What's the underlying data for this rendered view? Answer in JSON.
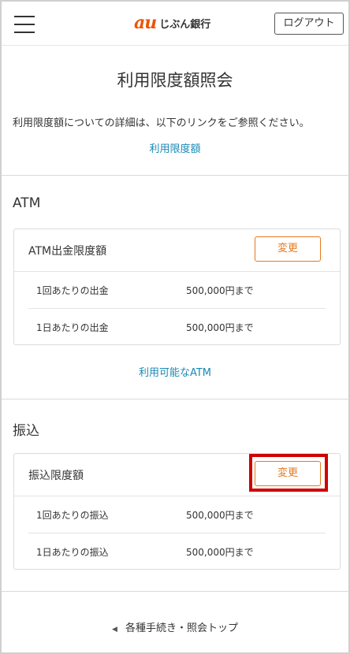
{
  "header": {
    "logo_mark": "au",
    "logo_text": "じぶん銀行",
    "logout_label": "ログアウト"
  },
  "page": {
    "title": "利用限度額照会",
    "intro": "利用限度額についての詳細は、以下のリンクをご参照ください。",
    "limit_link": "利用限度額"
  },
  "atm": {
    "section_title": "ATM",
    "card_title": "ATM出金限度額",
    "change_label": "変更",
    "rows": [
      {
        "label": "1回あたりの出金",
        "value": "500,000円まで"
      },
      {
        "label": "1日あたりの出金",
        "value": "500,000円まで"
      }
    ],
    "available_link": "利用可能なATM"
  },
  "transfer": {
    "section_title": "振込",
    "card_title": "振込限度額",
    "change_label": "変更",
    "rows": [
      {
        "label": "1回あたりの振込",
        "value": "500,000円まで"
      },
      {
        "label": "1日あたりの振込",
        "value": "500,000円まで"
      }
    ]
  },
  "footer": {
    "back_link": "各種手続き・照会トップ"
  },
  "colors": {
    "accent": "#e6791f",
    "brand": "#eb5505",
    "link": "#1a8ab5",
    "highlight": "#d00000"
  }
}
